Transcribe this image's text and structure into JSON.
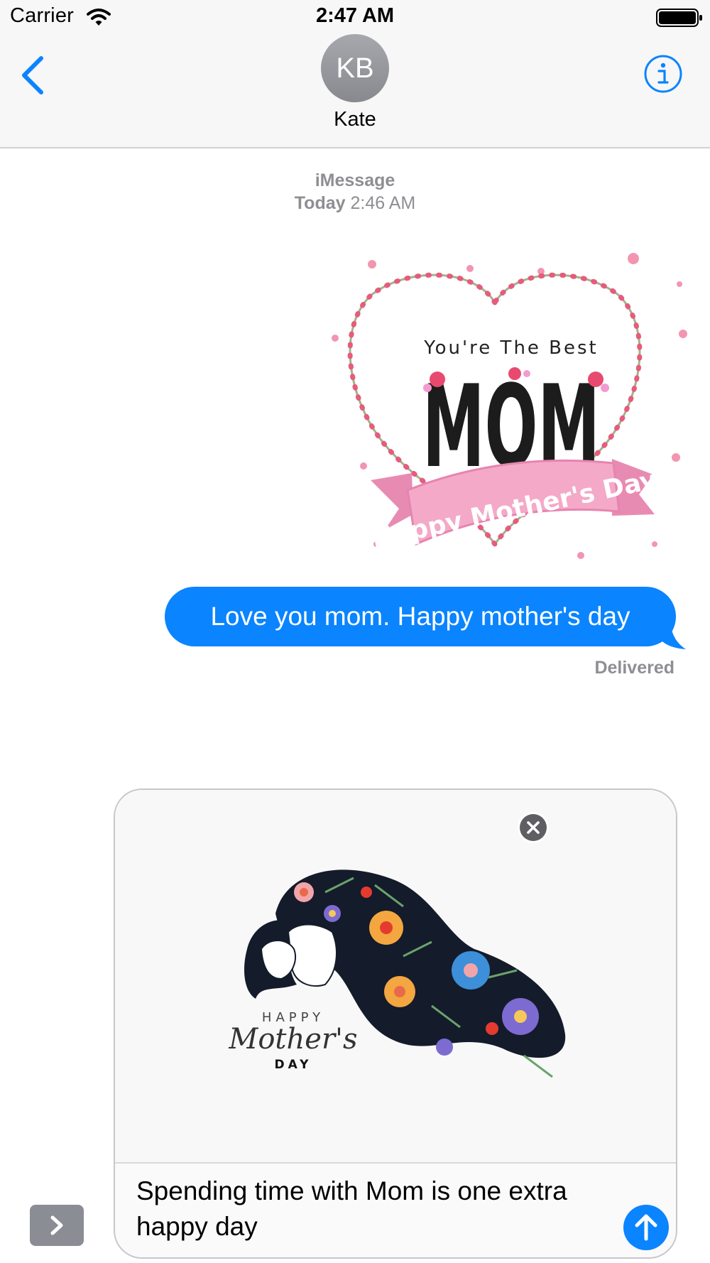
{
  "status_bar": {
    "carrier": "Carrier",
    "time": "2:47 AM"
  },
  "header": {
    "avatar_initials": "KB",
    "contact_name": "Kate"
  },
  "thread": {
    "service": "iMessage",
    "day": "Today",
    "timestamp": "2:46 AM",
    "stickers": [
      {
        "name": "mom-sticker",
        "line1": "You're The Best",
        "line2": "MOM",
        "ribbon": "Happy Mother's Day"
      }
    ],
    "messages": [
      {
        "text": "Love you mom. Happy mother's day",
        "status": "Delivered"
      }
    ]
  },
  "compose": {
    "attachment": {
      "happy": "HAPPY",
      "mothers": "Mother's",
      "day": "DAY"
    },
    "text": "Spending time with Mom is one extra happy day"
  },
  "colors": {
    "accent": "#0A84FF",
    "muted": "#8E8E93",
    "ribbon": "#F4A9C8"
  },
  "icons": [
    "wifi-icon",
    "battery-icon",
    "back-chevron-icon",
    "info-icon",
    "remove-attachment-icon",
    "apps-chevron-icon",
    "send-arrow-icon"
  ]
}
